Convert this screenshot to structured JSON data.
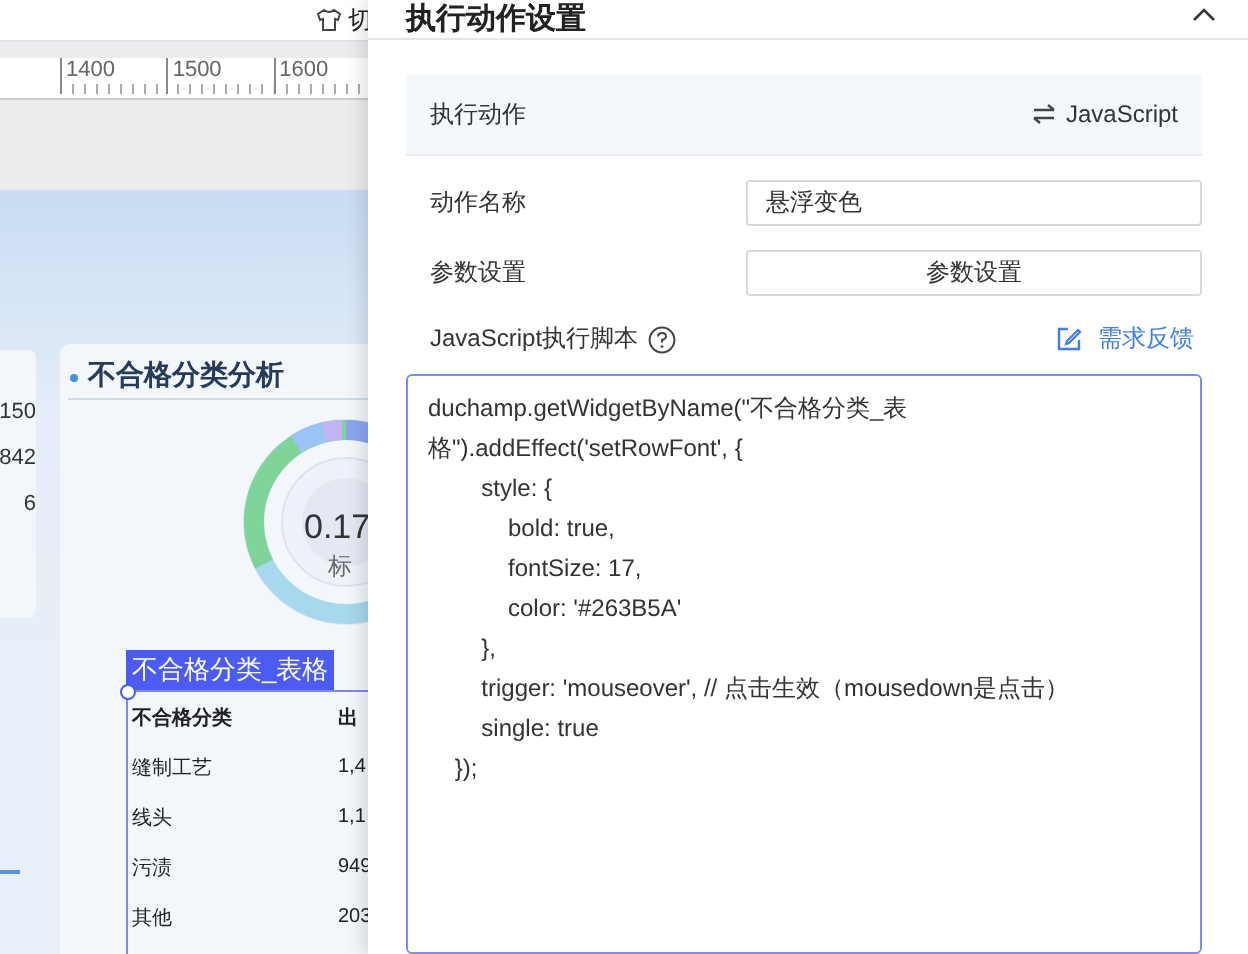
{
  "toolbar": {
    "switch_label": "切"
  },
  "ruler": {
    "marks": [
      "1400",
      "1500",
      "1600"
    ]
  },
  "stats_card": {
    "values": [
      "150",
      "842",
      "6"
    ]
  },
  "chart_card": {
    "title": "不合格分类分析",
    "center_value": "0.17",
    "center_label": "标"
  },
  "table_widget": {
    "tag": "不合格分类_表格",
    "selected": true,
    "columns": [
      "不合格分类",
      "出"
    ],
    "rows": [
      [
        "缝制工艺",
        "1,4"
      ],
      [
        "线头",
        "1,1"
      ],
      [
        "污渍",
        "949"
      ],
      [
        "其他",
        "203"
      ]
    ]
  },
  "panel": {
    "title": "执行动作设置",
    "action": {
      "label": "执行动作",
      "type": "JavaScript"
    },
    "fields": [
      {
        "kind": "input",
        "label": "动作名称",
        "value": "悬浮变色"
      },
      {
        "kind": "button",
        "label": "参数设置",
        "button": "参数设置"
      }
    ],
    "script": {
      "label": "JavaScript执行脚本",
      "feedback": "需求反馈",
      "code_lines": [
        "duchamp.getWidgetByName(\"不合格分类_表",
        "格\").addEffect('setRowFont', {",
        "        style: {",
        "            bold: true,",
        "            fontSize: 17,",
        "            color: '#263B5A'",
        "        },",
        "        trigger: 'mouseover', // 点击生效（mousedown是点击）",
        "        single: true",
        "    });"
      ]
    }
  }
}
